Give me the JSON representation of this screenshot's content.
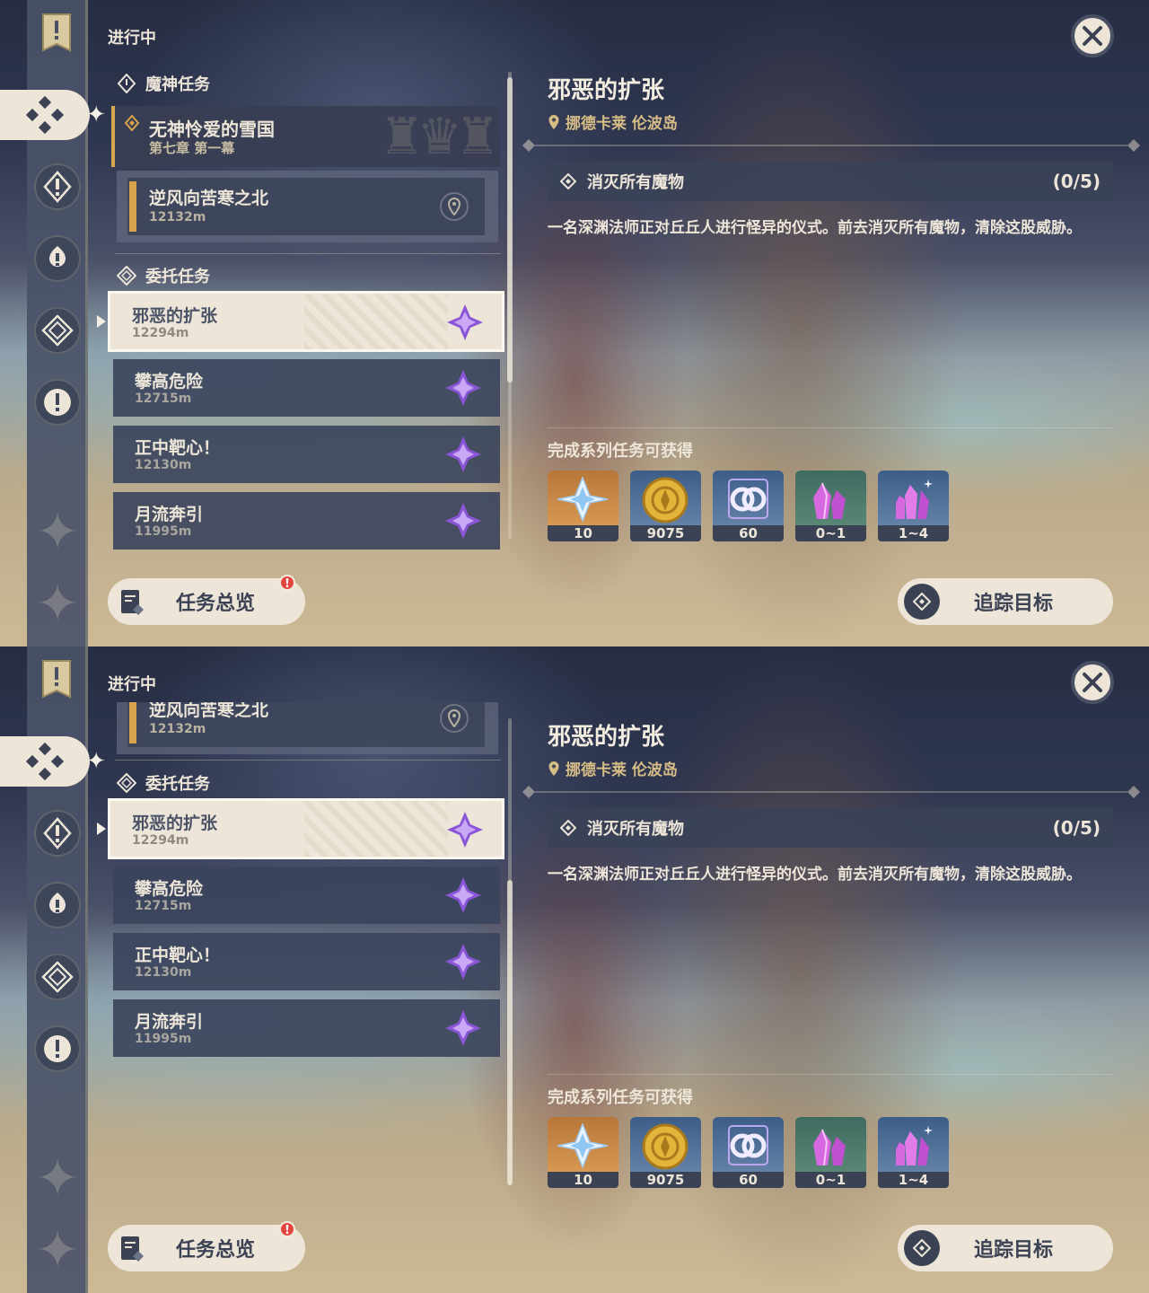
{
  "panels": [
    {
      "section_title": "进行中",
      "archon_category": "魔神任务",
      "archon_quest": {
        "title": "无神怜爱的雪国",
        "chapter": "第七章 第一幕"
      },
      "sub_quest": {
        "title": "逆风向苦寒之北",
        "distance": "12132m"
      },
      "commission_category": "委托任务",
      "quests": [
        {
          "title": "邪恶的扩张",
          "distance": "12294m"
        },
        {
          "title": "攀高危险",
          "distance": "12715m"
        },
        {
          "title": "正中靶心！",
          "distance": "12130m"
        },
        {
          "title": "月流奔引",
          "distance": "11995m"
        }
      ],
      "overview_button": "任务总览",
      "overview_badge": "!",
      "track_button": "追踪目标"
    },
    {
      "section_title": "进行中",
      "sub_quest": {
        "title": "逆风向苦寒之北",
        "distance": "12132m"
      },
      "commission_category": "委托任务",
      "quests": [
        {
          "title": "邪恶的扩张",
          "distance": "12294m"
        },
        {
          "title": "攀高危险",
          "distance": "12715m"
        },
        {
          "title": "正中靶心！",
          "distance": "12130m"
        },
        {
          "title": "月流奔引",
          "distance": "11995m"
        }
      ],
      "overview_button": "任务总览",
      "overview_badge": "!",
      "track_button": "追踪目标"
    }
  ],
  "detail": {
    "title": "邪恶的扩张",
    "location": "挪德卡莱 伦波岛",
    "objective": "消灭所有魔物",
    "objective_count": "(0/5)",
    "description": "一名深渊法师正对丘丘人进行怪异的仪式。前去消灭所有魔物，清除这股威胁。",
    "rewards_heading": "完成系列任务可获得",
    "rewards": [
      {
        "icon": "primogem-icon",
        "count": "10"
      },
      {
        "icon": "mora-coin-icon",
        "count": "9075"
      },
      {
        "icon": "companionship-exp-icon",
        "count": "60"
      },
      {
        "icon": "crystal-chunk-icon",
        "count": "0~1"
      },
      {
        "icon": "crystal-cluster-icon",
        "count": "1~4"
      }
    ]
  },
  "colors": {
    "accent_gold": "#d9a34b",
    "cream": "#ece5d8",
    "panel_dark": "#3b4254",
    "star_purple": "#8a55d6"
  }
}
